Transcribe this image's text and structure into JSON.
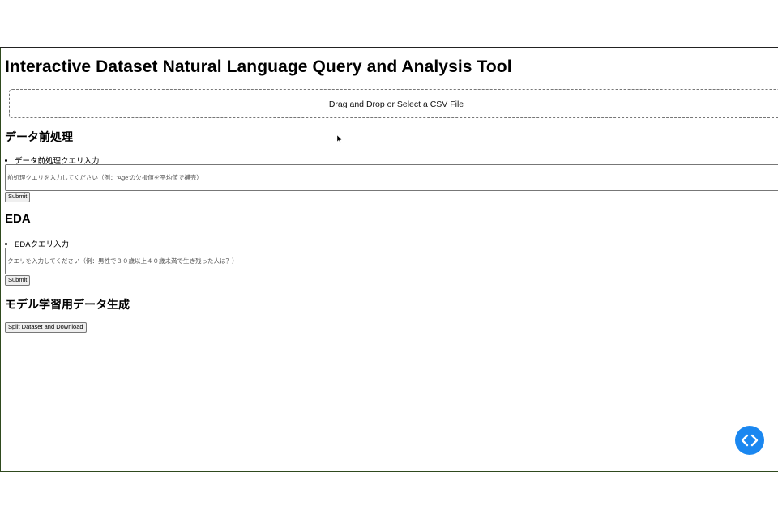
{
  "app": {
    "title": "Interactive Dataset Natural Language Query and Analysis Tool"
  },
  "upload": {
    "label": "Drag and Drop or Select a CSV File"
  },
  "preprocessing": {
    "heading": "データ前処理",
    "query_label": "データ前処理クエリ入力",
    "placeholder": "前処理クエリを入力してください（例：'Age'の欠損値を平均値で補完）",
    "submit_label": "Submit"
  },
  "eda": {
    "heading": "EDA",
    "query_label": "EDAクエリ入力",
    "placeholder": "クエリを入力してください（例：男性で３０歳以上４０歳未満で生き残った人は？）",
    "submit_label": "Submit"
  },
  "model_data": {
    "heading": "モデル学習用データ生成",
    "button_label": "Split Dataset and Download"
  },
  "fab": {
    "icon": "code-icon",
    "color": "#1a87f0"
  }
}
